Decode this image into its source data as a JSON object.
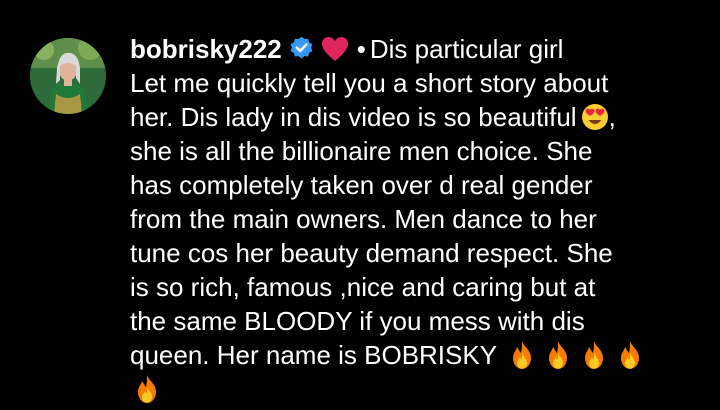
{
  "comment": {
    "username": "bobrisky222",
    "verified_icon": "verified-badge-icon",
    "heart_icon": "red-heart-emoji",
    "bullet": "•",
    "lines": [
      "Dis particular girl",
      "Let me quickly tell you a short story about",
      "her. Dis lady in dis video is so beautiful",
      "she is all the billionaire men choice. She",
      "has completely taken over d real gender",
      "from the main owners. Men dance to her",
      "tune cos her beauty demand respect. She",
      "is so rich, famous ,nice and caring but at",
      "the same BLOODY if you mess with dis",
      "queen. Her name is BOBRISKY"
    ],
    "after_emoji_comma": ",",
    "emoji_heart_eyes": "smiling-face-with-heart-eyes-emoji",
    "fire_emoji": "fire-emoji",
    "fire_count_line": 4,
    "fire_count_wrap": 1
  },
  "colors": {
    "background": "#000000",
    "text": "#ffffff",
    "verified": "#3897f0",
    "heart": "#e0245e"
  }
}
